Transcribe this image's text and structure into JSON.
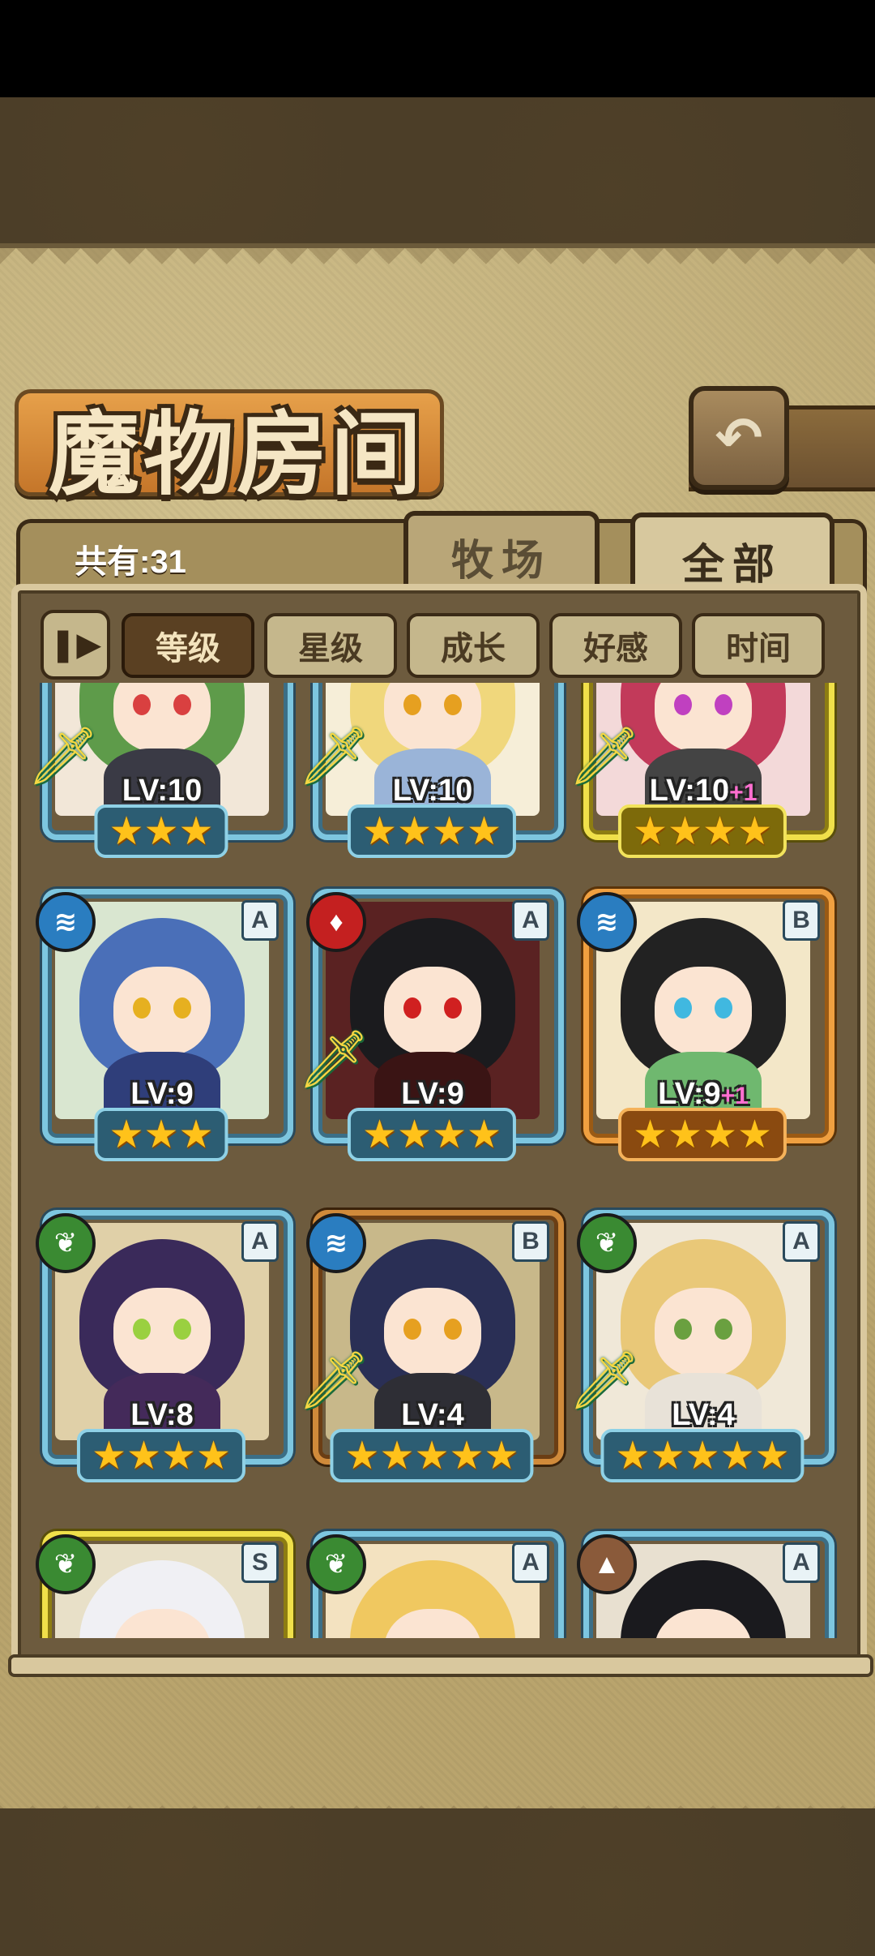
{
  "header": {
    "title": "魔物房间",
    "back_icon": "return-icon"
  },
  "summary": {
    "count_label": "共有:31"
  },
  "tabs": [
    {
      "label": "牧场",
      "selected": false
    },
    {
      "label": "全部",
      "selected": true
    }
  ],
  "sort": {
    "toggle_icon": "pause-icon",
    "options": [
      {
        "label": "等级",
        "active": true
      },
      {
        "label": "星级",
        "active": false
      },
      {
        "label": "成长",
        "active": false
      },
      {
        "label": "好感",
        "active": false
      },
      {
        "label": "时间",
        "active": false
      }
    ]
  },
  "monsters": [
    {
      "lv": "LV:10",
      "plus": "",
      "stars": "★★★",
      "element": "",
      "grade": "",
      "sword": true
    },
    {
      "lv": "LV:10",
      "plus": "",
      "stars": "★★★★",
      "element": "",
      "grade": "",
      "sword": true
    },
    {
      "lv": "LV:10",
      "plus": "+1",
      "stars": "★★★★",
      "element": "",
      "grade": "",
      "sword": true
    },
    {
      "lv": "LV:9",
      "plus": "",
      "stars": "★★★",
      "element": "water",
      "grade": "A",
      "sword": false
    },
    {
      "lv": "LV:9",
      "plus": "",
      "stars": "★★★★",
      "element": "fire",
      "grade": "A",
      "sword": true
    },
    {
      "lv": "LV:9",
      "plus": "+1",
      "stars": "★★★★",
      "element": "water",
      "grade": "B",
      "sword": false
    },
    {
      "lv": "LV:8",
      "plus": "",
      "stars": "★★★★",
      "element": "grass",
      "grade": "A",
      "sword": false
    },
    {
      "lv": "LV:4",
      "plus": "",
      "stars": "★★★★★",
      "element": "water",
      "grade": "B",
      "sword": true
    },
    {
      "lv": "LV:4",
      "plus": "",
      "stars": "★★★★★",
      "element": "grass",
      "grade": "A",
      "sword": true
    },
    {
      "lv": "",
      "plus": "",
      "stars": "",
      "element": "grass",
      "grade": "S",
      "sword": false
    },
    {
      "lv": "",
      "plus": "",
      "stars": "",
      "element": "grass",
      "grade": "A",
      "sword": false
    },
    {
      "lv": "",
      "plus": "",
      "stars": "",
      "element": "earth",
      "grade": "A",
      "sword": false
    }
  ]
}
